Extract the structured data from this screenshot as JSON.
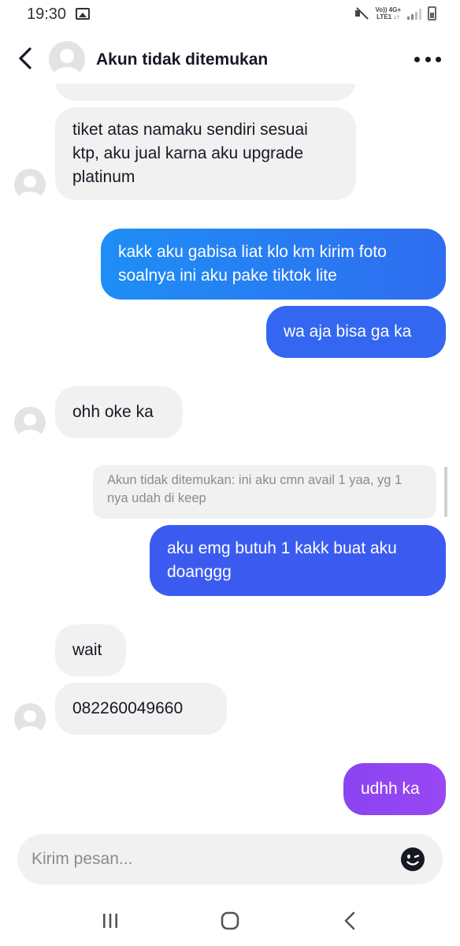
{
  "status_bar": {
    "time": "19:30",
    "network_top": "Vo)) 4G+",
    "network_bottom": "LTE1 ↓↑",
    "icons": [
      "gallery-icon",
      "mute-icon",
      "signal-icon",
      "battery-icon"
    ]
  },
  "header": {
    "title": "Akun tidak ditemukan",
    "back_icon": "chevron-left-icon",
    "more_icon": "more-horizontal-icon"
  },
  "messages": [
    {
      "from": "other",
      "text": "tiket atas namaku sendiri sesuai ktp, aku jual karna aku upgrade platinum"
    },
    {
      "from": "me",
      "text": "kakk aku gabisa liat klo km kirim foto soalnya ini aku pake tiktok lite"
    },
    {
      "from": "me",
      "text": "wa aja bisa ga ka"
    },
    {
      "from": "other",
      "text": "ohh oke ka"
    },
    {
      "from": "me",
      "quote": "Akun tidak ditemukan: ini aku cmn avail 1 yaa, yg 1 nya udah di keep",
      "text": "aku emg butuh 1 kakk buat aku doanggg"
    },
    {
      "from": "other",
      "text": "wait"
    },
    {
      "from": "other",
      "text": "082260049660"
    },
    {
      "from": "me",
      "text": "udhh ka"
    }
  ],
  "composer": {
    "placeholder": "Kirim pesan...",
    "emoji_icon": "emoji-icon"
  },
  "colors": {
    "bubble_in": "#f1f1f2",
    "bubble_out_blue_start": "#1e8ef5",
    "bubble_out_blue_end": "#2f6df0",
    "bubble_out_indigo": "#3b5bf0",
    "bubble_out_purple": "#8f45f2",
    "text": "#161823",
    "muted": "#8a8b91"
  }
}
